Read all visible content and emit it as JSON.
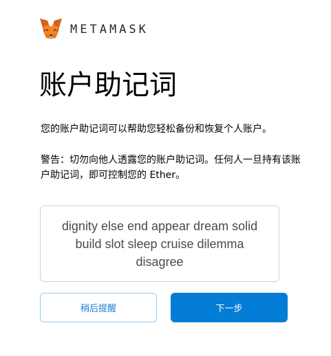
{
  "header": {
    "logo_icon": "metamask-fox-icon",
    "wordmark": "METAMASK"
  },
  "main": {
    "title": "账户助记词",
    "description": "您的账户助记词可以帮助您轻松备份和恢复个人账户。",
    "warning": "警告：切勿向他人透露您的账户助记词。任何人一旦持有该账户助记词，即可控制您的 Ether。",
    "seed_phrase": "dignity else end appear dream solid build slot sleep cruise dilemma disagree"
  },
  "actions": {
    "remind_later_label": "稍后提醒",
    "next_label": "下一步"
  },
  "colors": {
    "primary": "#037dd6",
    "secondary_text": "#1d7ed1",
    "secondary_border": "#9bc8ea",
    "phrase_border": "#cfd3d7",
    "fox_orange": "#e2761b"
  }
}
